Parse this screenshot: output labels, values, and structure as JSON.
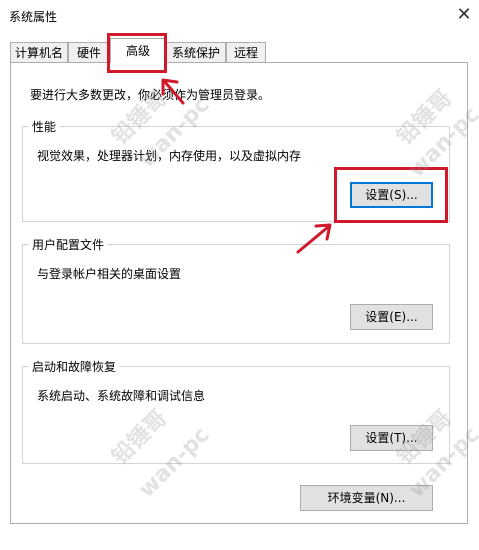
{
  "window": {
    "title": "系统属性",
    "close_glyph": "✕"
  },
  "tabs": [
    {
      "label": "计算机名"
    },
    {
      "label": "硬件"
    },
    {
      "label": "高级"
    },
    {
      "label": "系统保护"
    },
    {
      "label": "远程"
    }
  ],
  "advanced": {
    "admin_note": "要进行大多数更改，你必须作为管理员登录。",
    "performance": {
      "label": "性能",
      "description": "视觉效果，处理器计划，内存使用，以及虚拟内存",
      "button": "设置(S)..."
    },
    "user_profiles": {
      "label": "用户配置文件",
      "description": "与登录帐户相关的桌面设置",
      "button": "设置(E)..."
    },
    "startup_recovery": {
      "label": "启动和故障恢复",
      "description": "系统启动、系统故障和调试信息",
      "button": "设置(T)..."
    },
    "env_button": "环境变量(N)..."
  },
  "watermark": {
    "line1": "铅锤哥",
    "line2": "wan-pc"
  },
  "colors": {
    "highlight": "#d0192b",
    "focus": "#0078d7"
  }
}
